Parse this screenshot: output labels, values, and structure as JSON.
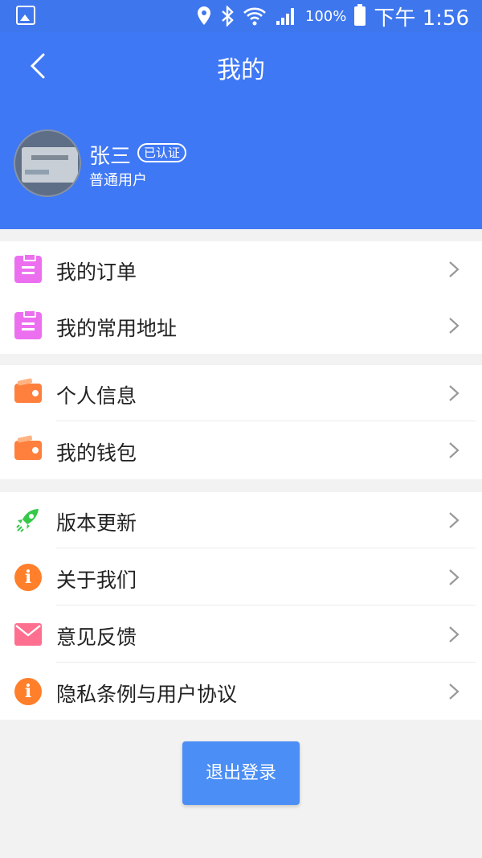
{
  "status_bar": {
    "battery": "100%",
    "time": "下午 1:56"
  },
  "header": {
    "title": "我的"
  },
  "profile": {
    "name": "张三",
    "verified": "已认证",
    "user_type": "普通用户"
  },
  "groups": [
    {
      "items": [
        {
          "label": "我的订单",
          "icon": "clipboard-icon"
        },
        {
          "label": "我的常用地址",
          "icon": "clipboard-icon"
        }
      ]
    },
    {
      "items": [
        {
          "label": "个人信息",
          "icon": "wallet-icon"
        },
        {
          "label": "我的钱包",
          "icon": "wallet-icon"
        }
      ]
    },
    {
      "items": [
        {
          "label": "版本更新",
          "icon": "rocket-icon"
        },
        {
          "label": "关于我们",
          "icon": "info-icon"
        },
        {
          "label": "意见反馈",
          "icon": "mail-icon"
        },
        {
          "label": "隐私条例与用户协议",
          "icon": "info-icon"
        }
      ]
    }
  ],
  "actions": {
    "logout": "退出登录"
  },
  "colors": {
    "header": "#3f78f5",
    "button": "#4b8ef5",
    "clipboard": "#ec6ff0",
    "wallet": "#ff7f3d",
    "info": "#ff7f2a",
    "mail": "#ff6f8f",
    "rocket": "#37c84a"
  }
}
